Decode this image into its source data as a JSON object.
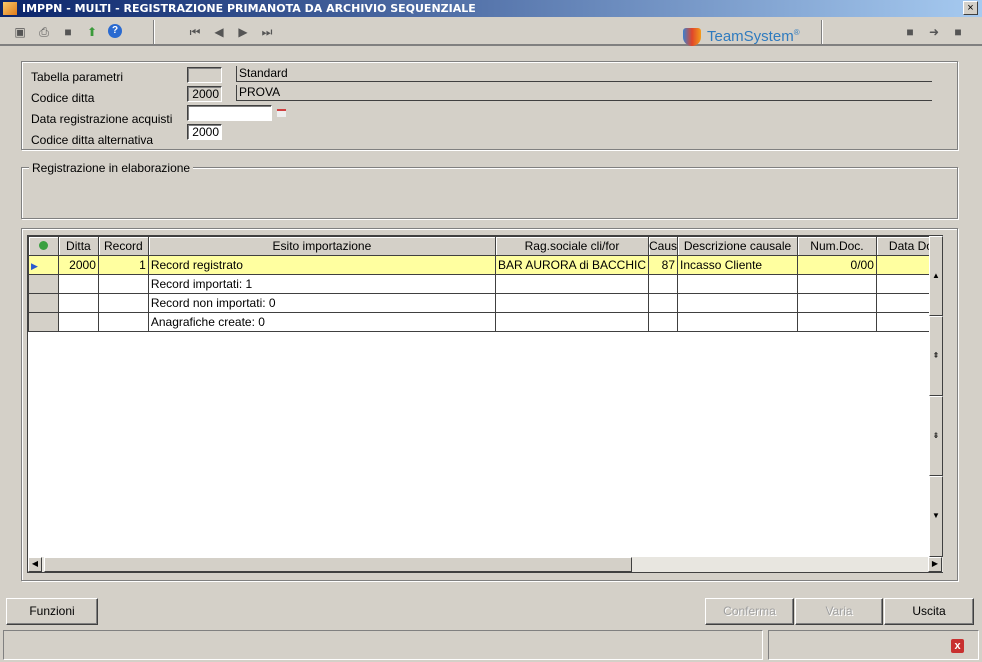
{
  "window": {
    "title": "IMPPN  - MULTI -  REGISTRAZIONE PRIMANOTA DA ARCHIVIO SEQUENZIALE",
    "close": "×"
  },
  "toolbar": {
    "icons": [
      "preview-icon",
      "print-icon",
      "export-icon",
      "import-icon",
      "help-icon"
    ],
    "nav": [
      "first-record-icon",
      "previous-record-icon",
      "next-record-icon",
      "last-record-icon"
    ],
    "brand": "TeamSystem",
    "brand_mark": "®"
  },
  "form": {
    "tabella_parametri": {
      "label": "Tabella parametri",
      "code": "",
      "description": "Standard"
    },
    "codice_ditta": {
      "label": "Codice ditta",
      "code": "2000",
      "description": "PROVA"
    },
    "data_registrazione": {
      "label": "Data registrazione acquisti",
      "value": ""
    },
    "codice_ditta_alternativa": {
      "label": "Codice ditta alternativa",
      "value": "2000"
    }
  },
  "elaborazione": {
    "title": "Registrazione in elaborazione"
  },
  "grid": {
    "columns": [
      "Ditta",
      "Record",
      "Esito importazione",
      "Rag.sociale cli/for",
      "Caus",
      "Descrizione causale",
      "Num.Doc.",
      "Data Doc"
    ],
    "rows": [
      [
        "2000",
        "1",
        "Record registrato",
        "BAR AURORA di BACCHIC",
        "87",
        "Incasso Cliente",
        "0/00",
        ""
      ],
      [
        "",
        "",
        "Record importati: 1",
        "",
        "",
        "",
        "",
        ""
      ],
      [
        "",
        "",
        "Record non importati: 0",
        "",
        "",
        "",
        "",
        ""
      ],
      [
        "",
        "",
        "Anagrafiche create: 0",
        "",
        "",
        "",
        "",
        ""
      ]
    ]
  },
  "buttons": {
    "funzioni": "Funzioni",
    "conferma": "Conferma",
    "varia": "Varia",
    "uscita": "Uscita"
  },
  "colors": {
    "selected_row": "#ffffa0",
    "title_bar": "#0a246a",
    "face": "#d4d0c8"
  }
}
